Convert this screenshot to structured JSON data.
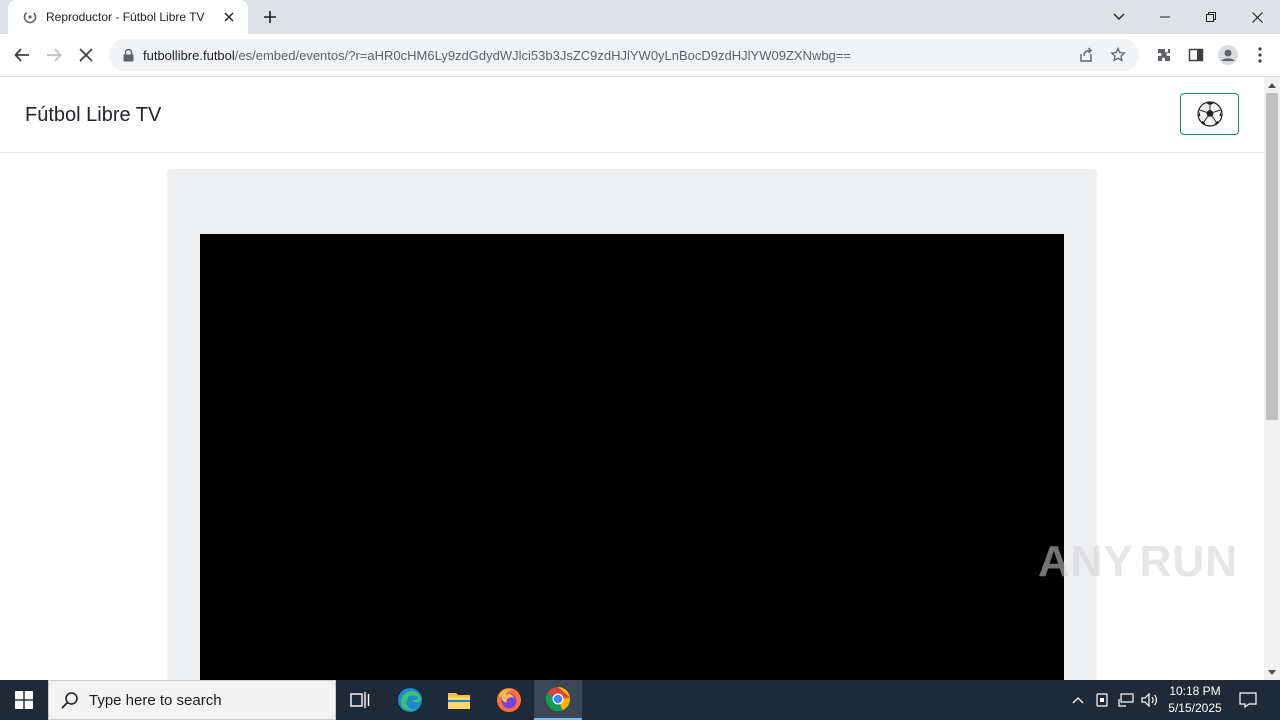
{
  "browser": {
    "tab_title": "Reproductor - Fútbol Libre TV",
    "url_host": "futbollibre.futbol",
    "url_path": "/es/embed/eventos/?r=aHR0cHM6Ly9zdGdydWJlci53b3JsZC9zdHJlYW0yLnBocD9zdHJlYW09ZXNwbg=="
  },
  "page": {
    "brand": "Fútbol Libre TV"
  },
  "watermark": {
    "left": "ANY",
    "right": "RUN"
  },
  "taskbar": {
    "search_placeholder": "Type here to search",
    "time": "10:18 PM",
    "date": "5/15/2025"
  },
  "colors": {
    "tab_strip": "#dee1e6",
    "player_card": "#eceef0",
    "ball_button_border": "#198754",
    "taskbar": "#1f2a38"
  }
}
